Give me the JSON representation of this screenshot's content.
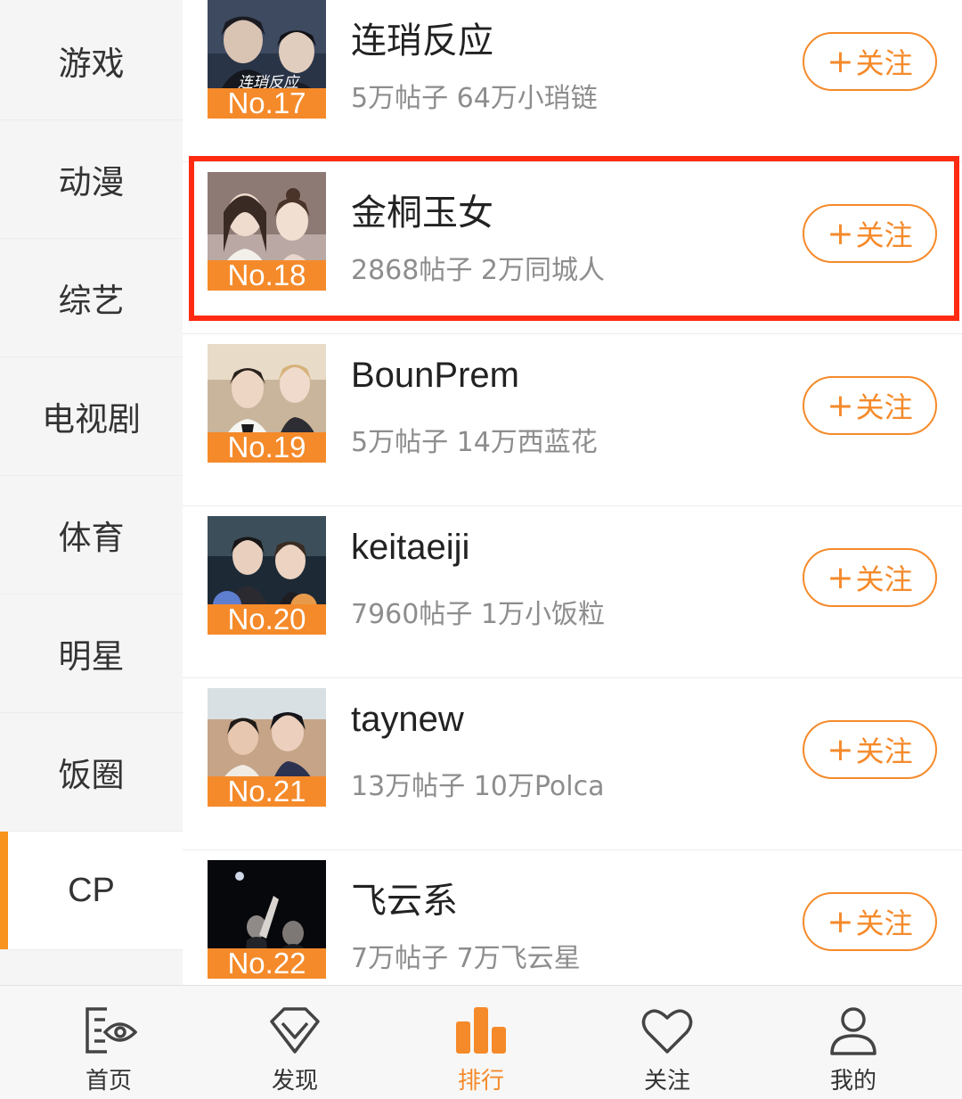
{
  "sidebar": {
    "items": [
      {
        "label": "游戏",
        "active": false
      },
      {
        "label": "动漫",
        "active": false
      },
      {
        "label": "综艺",
        "active": false
      },
      {
        "label": "电视剧",
        "active": false
      },
      {
        "label": "体育",
        "active": false
      },
      {
        "label": "明星",
        "active": false
      },
      {
        "label": "饭圈",
        "active": false
      },
      {
        "label": "CP",
        "active": true
      }
    ]
  },
  "list": {
    "follow_label": "关注",
    "follow_plus": "+",
    "items": [
      {
        "rank": "No.17",
        "name": "连琑反应",
        "meta": "5万帖子 64万小琑链",
        "thumb_caption": "连琑反应"
      },
      {
        "rank": "No.18",
        "name": "金桐玉女",
        "meta": "2868帖子 2万同城人",
        "highlighted": true
      },
      {
        "rank": "No.19",
        "name": "BounPrem",
        "meta": "5万帖子 14万西蓝花"
      },
      {
        "rank": "No.20",
        "name": "keitaeiji",
        "meta": "7960帖子 1万小饭粒"
      },
      {
        "rank": "No.21",
        "name": "taynew",
        "meta": "13万帖子 10万Polca"
      },
      {
        "rank": "No.22",
        "name": "飞云系",
        "meta": "7万帖子 7万飞云星"
      }
    ]
  },
  "bottom_nav": {
    "items": [
      {
        "label": "首页",
        "icon": "home-eye-icon",
        "active": false
      },
      {
        "label": "发现",
        "icon": "diamond-icon",
        "active": false
      },
      {
        "label": "排行",
        "icon": "ranking-bars-icon",
        "active": true
      },
      {
        "label": "关注",
        "icon": "heart-icon",
        "active": false
      },
      {
        "label": "我的",
        "icon": "user-icon",
        "active": false
      }
    ]
  },
  "colors": {
    "accent": "#f58a2a",
    "highlight_border": "#ff2a12",
    "sidebar_bg": "#f5f5f5",
    "meta_text": "#8d8d8d"
  }
}
